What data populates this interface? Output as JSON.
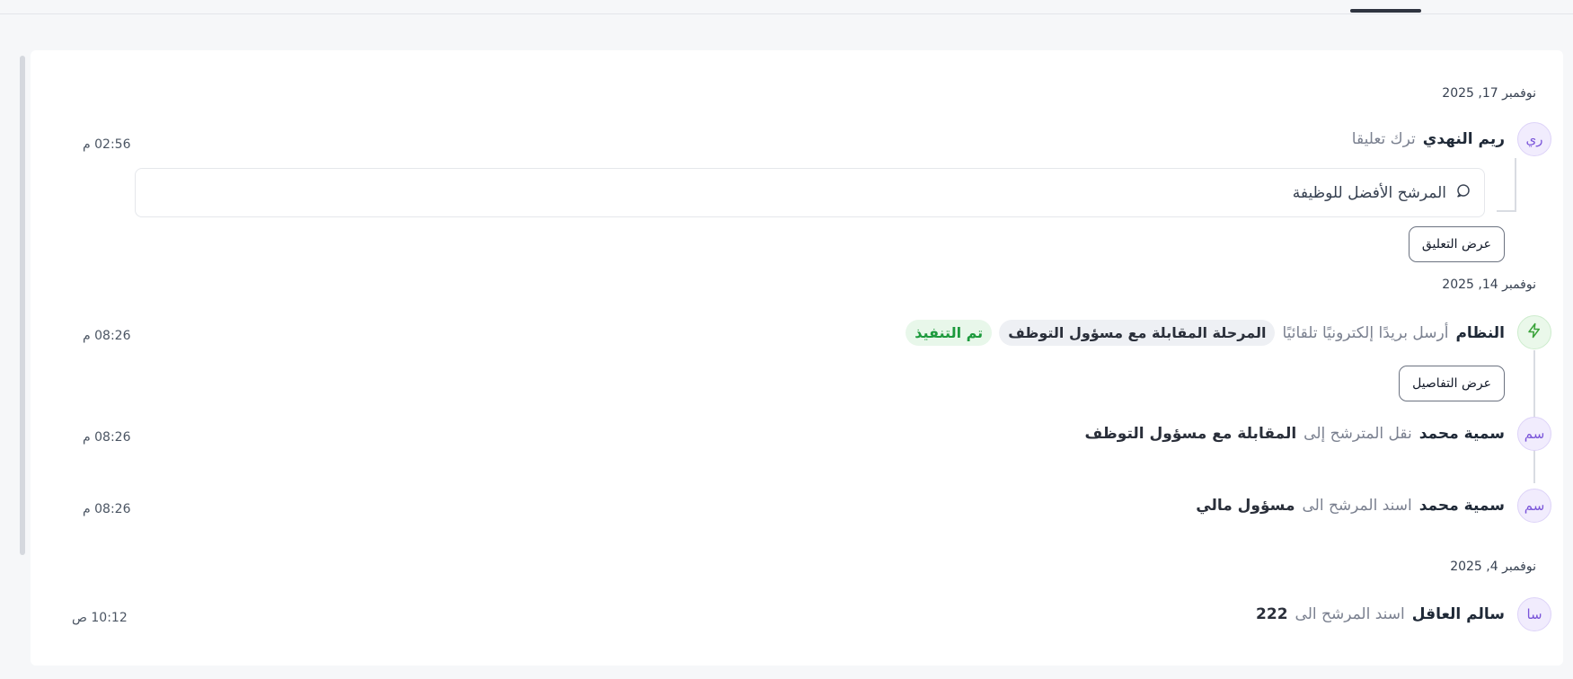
{
  "timeline": {
    "groups": [
      {
        "date": "نوفمبر 17, 2025",
        "events": [
          {
            "avatar_initials": "ري",
            "actor": "ريم النهدي",
            "verb": "ترك تعليقا",
            "time": "02:56 م",
            "comment_text": "المرشح الأفضل للوظيفة",
            "button_label": "عرض التعليق"
          }
        ]
      },
      {
        "date": "نوفمبر 14, 2025",
        "events": [
          {
            "avatar_icon": "lightning-icon",
            "actor": "النظام",
            "verb": "أرسل بريدًا إلكترونيًا تلقائيًا",
            "stage_badge": "المرحلة المقابلة مع مسؤول التوظف",
            "status_badge": "تم التنفيذ",
            "time": "08:26 م",
            "button_label": "عرض التفاصيل"
          },
          {
            "avatar_initials": "سم",
            "actor": "سمية محمد",
            "verb": "نقل المترشح إلى",
            "target": "المقابلة مع مسؤول التوظف",
            "time": "08:26 م"
          },
          {
            "avatar_initials": "سم",
            "actor": "سمية محمد",
            "verb": "اسند المرشح الى",
            "target": "مسؤول مالي",
            "time": "08:26 م"
          }
        ]
      },
      {
        "date": "نوفمبر 4, 2025",
        "events": [
          {
            "avatar_initials": "سا",
            "actor": "سالم العاقل",
            "verb": "اسند المرشح الى",
            "target": "222",
            "time": "10:12 ص"
          }
        ]
      }
    ]
  },
  "colors": {
    "avatar_bg": "#f1ecfd",
    "avatar_text": "#7a55d9",
    "system_avatar": "#3aa33a",
    "success_badge_text": "#1d9a3d"
  }
}
